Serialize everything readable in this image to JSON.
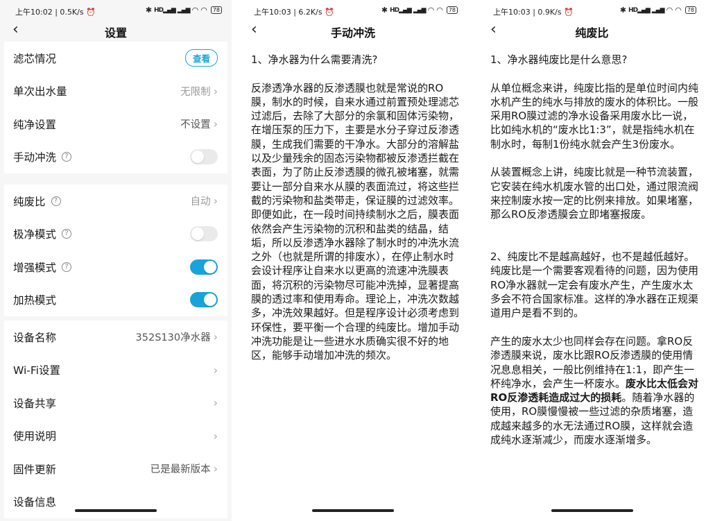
{
  "screens": [
    {
      "status": {
        "time": "上午10:02",
        "speed": "0.5K/s",
        "battery": "78"
      },
      "title": "设置",
      "group1": [
        {
          "label": "滤芯情况",
          "button": "查看"
        },
        {
          "label": "单次出水量",
          "value": "无限制"
        },
        {
          "label": "纯净设置",
          "value": "不设置"
        },
        {
          "label": "手动冲洗",
          "help": true,
          "toggle": false
        }
      ],
      "group2": [
        {
          "label": "纯废比",
          "help": true,
          "value": "自动"
        },
        {
          "label": "极净模式",
          "help": true,
          "toggle": false
        },
        {
          "label": "增强模式",
          "help": true,
          "toggle": true
        },
        {
          "label": "加热模式",
          "toggle": true
        }
      ],
      "group3": [
        {
          "label": "设备名称",
          "value": "352S130净水器"
        },
        {
          "label": "Wi-Fi设置",
          "value": ""
        },
        {
          "label": "设备共享",
          "value": ""
        },
        {
          "label": "使用说明",
          "value": ""
        },
        {
          "label": "固件更新",
          "value": "已是最新版本"
        },
        {
          "label": "设备信息",
          "value": ""
        }
      ]
    },
    {
      "status": {
        "time": "上午10:03",
        "speed": "6.2K/s",
        "battery": "78"
      },
      "title": "手动冲洗",
      "paragraphs": [
        "1、净水器为什么需要清洗?",
        "反渗透净水器的反渗透膜也就是常说的RO膜，制水的时候，自来水通过前置预处理滤芯过滤后，去除了大部分的余氯和固体污染物，在增压泵的压力下，主要是水分子穿过反渗透膜，生成我们需要的干净水。大部分的溶解盐以及少量残余的固态污染物都被反渗透拦截在表面，为了防止反渗透膜的微孔被堵塞，就需要让一部分自来水从膜的表面流过，将这些拦截的污染物和盐类带走，保证膜的过滤效率。即便如此，在一段时间持续制水之后，膜表面依然会产生污染物的沉积和盐类的结晶，结垢，所以反渗透净水器除了制水时的冲洗水流之外（也就是所谓的排废水），在停止制水时会设计程序让自来水以更高的流速冲洗膜表面，将沉积的污染物尽可能冲洗掉，显著提高膜的透过率和使用寿命。理论上，冲洗次数越多，冲洗效果越好。但是程序设计必须考虑到环保性，要平衡一个合理的纯废比。增加手动冲洗功能是让一些进水水质确实很不好的地区，能够手动增加冲洗的频次。"
      ]
    },
    {
      "status": {
        "time": "上午10:03",
        "speed": "0.9K/s",
        "battery": "78"
      },
      "title": "纯废比",
      "p1": "1、净水器纯废比是什么意思?",
      "p2": "从单位概念来讲，纯废比指的是单位时间内纯水机产生的纯水与排放的废水的体积比。一般采用RO膜过滤的净水设备采用废水比一说，比如纯水机的“废水比1:3”，就是指纯水机在制水时，每制1份纯水就会产生3份废水。",
      "p3": "从装置概念上讲，纯废比就是一种节流装置，它安装在纯水机废水管的出口处，通过限流阀来控制废水按一定的比例来排放。如果堵塞，那么RO反渗透膜会立即堵塞报废。",
      "p4a": "2、纯废比不是越高越好，也不是越低越好。",
      "p4b": "纯废比是一个需要客观看待的问题，因为使用RO净水器就一定会有废水产生，产生废水太多会不符合国家标准。这样的净水器在正规渠道用户是看不到的。",
      "p5a": "产生的废水太少也同样会存在问题。拿RO反渗透膜来说，废水比跟RO反渗透膜的使用情况息息相关，一般比例维持在1:1，即产生一杯纯净水，会产生一杯废水。",
      "p5bold": "废水比太低会对RO反渗透耗造成过大的损耗",
      "p5c": "。随着净水器的使用，RO膜慢慢被一些过滤的杂质堵塞，造成越来越多的水无法通过RO膜，这样就会造成纯水逐渐减少，而废水逐渐增多。"
    }
  ]
}
